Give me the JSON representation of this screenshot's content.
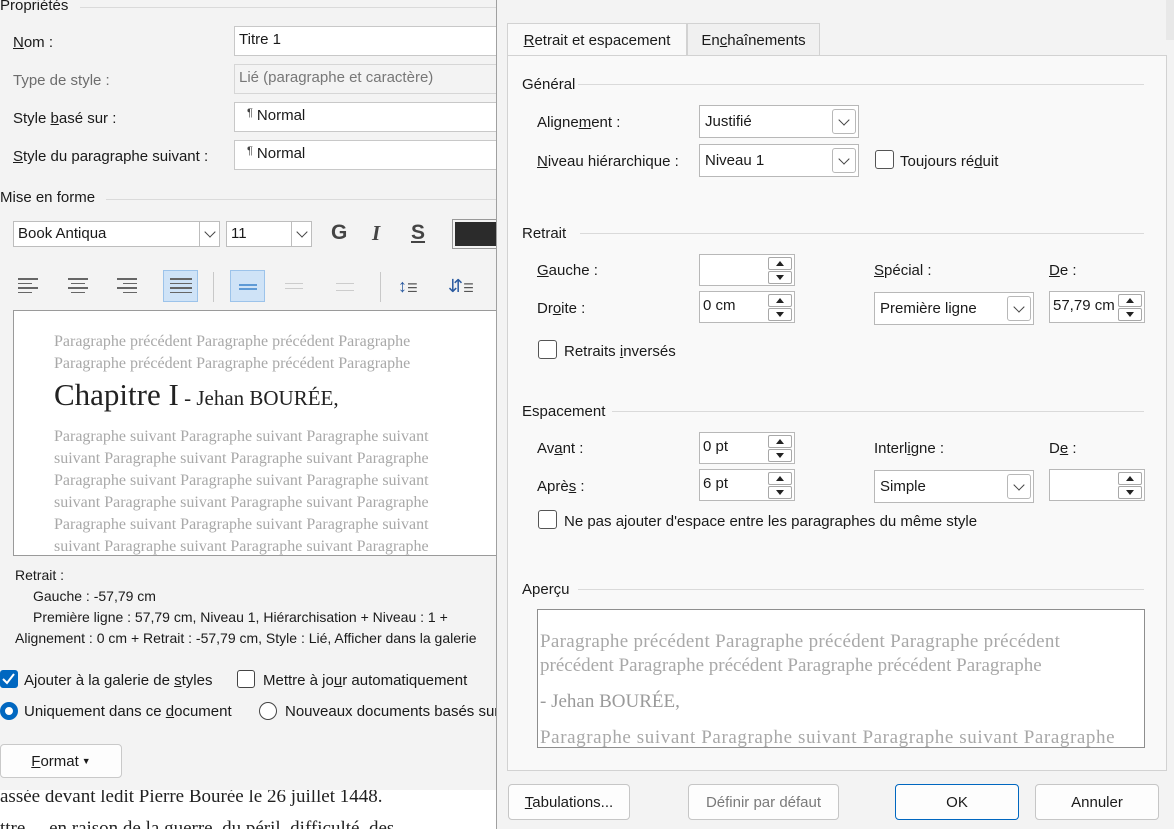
{
  "modify_style": {
    "properties_title": "Propriétés",
    "name_label": "Nom :",
    "name_value": "Titre 1",
    "type_label": "Type de style :",
    "type_value": "Lié (paragraphe et caractère)",
    "based_on_label": "Style basé sur :",
    "based_on_value": "Normal",
    "next_label": "Style du paragraphe suivant :",
    "next_value": "Normal",
    "pilcrow": "¶",
    "format_title": "Mise en forme",
    "font": "Book Antiqua",
    "size": "11",
    "bold": "G",
    "italic": "I",
    "strike": "S",
    "preview": {
      "prev1": "Paragraphe précédent Paragraphe précédent Paragraphe",
      "prev2": "Paragraphe précédent Paragraphe précédent Paragraphe",
      "heading_big": "Chapitre I",
      "heading_small": " - Jehan BOURÉE,",
      "next_lines": [
        "Paragraphe suivant Paragraphe suivant Paragraphe suivant",
        "suivant Paragraphe suivant Paragraphe suivant Paragraphe",
        "Paragraphe suivant Paragraphe suivant Paragraphe suivant",
        "suivant Paragraphe suivant Paragraphe suivant Paragraphe",
        "Paragraphe suivant Paragraphe suivant Paragraphe suivant",
        "suivant Paragraphe suivant Paragraphe suivant Paragraphe"
      ]
    },
    "description": {
      "line1": "Retrait :",
      "line2": "Gauche :  -57,79 cm",
      "line3": "Première ligne : 57,79 cm, Niveau 1, Hiérarchisation + Niveau : 1 +",
      "line4": "Alignement :  0 cm + Retrait :  -57,79 cm, Style : Lié, Afficher dans la galerie"
    },
    "add_gallery": "Ajouter à la galerie de styles",
    "auto_update": "Mettre à jour automatiquement",
    "only_document": "Uniquement dans ce document",
    "new_documents": "Nouveaux documents basés sur ce modèle",
    "format_button": "Format"
  },
  "background_doc": {
    "line1": "assée devant ledit Pierre Bourée le 26 juillet 1448.",
    "line2": "ttre..., en raison de la guerre, du péril, difficulté, des"
  },
  "paragraph_dialog": {
    "tabs": [
      "Retrait et espacement",
      "Enchaînements"
    ],
    "general": {
      "title": "Général",
      "alignment_label": "Alignement :",
      "alignment_value": "Justifié",
      "level_label": "Niveau hiérarchique :",
      "level_value": "Niveau 1",
      "collapsed_label": "Toujours réduit"
    },
    "indent": {
      "title": "Retrait",
      "left_label": "Gauche :",
      "left_value": "",
      "right_label": "Droite :",
      "right_value": "0 cm",
      "special_label": "Spécial :",
      "special_value": "Première ligne",
      "by_label": "De :",
      "by_value": "57,79 cm",
      "mirror_label": "Retraits inversés"
    },
    "spacing": {
      "title": "Espacement",
      "before_label": "Avant :",
      "before_value": "0 pt",
      "after_label": "Après :",
      "after_value": "6 pt",
      "line_label": "Interligne :",
      "line_value": "Simple",
      "at_label": "De :",
      "at_value": "",
      "no_space_label": "Ne pas ajouter d'espace entre les paragraphes du même style"
    },
    "preview": {
      "title": "Aperçu",
      "line1": "Paragraphe précédent Paragraphe précédent Paragraphe précédent",
      "line2": "précédent Paragraphe précédent Paragraphe précédent Paragraphe",
      "line3": "- Jehan BOURÉE,",
      "line4": "Paragraphe suivant Paragraphe suivant Paragraphe suivant Paragraphe"
    },
    "buttons": {
      "tabs": "Tabulations...",
      "default": "Définir par défaut",
      "ok": "OK",
      "cancel": "Annuler"
    }
  }
}
